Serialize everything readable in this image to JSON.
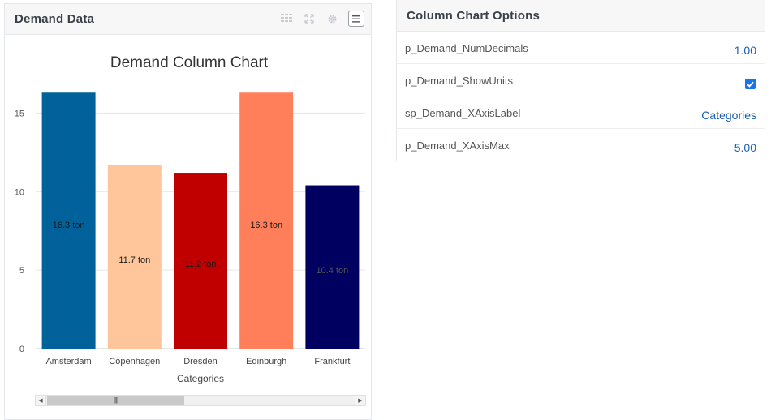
{
  "widget": {
    "title": "Demand Data",
    "icons": [
      "table-icon",
      "expand-icon",
      "gear-icon",
      "menu-icon"
    ]
  },
  "chart_data": {
    "type": "bar",
    "title": "Demand Column Chart",
    "xlabel": "Categories",
    "ylabel": "",
    "categories": [
      "Amsterdam",
      "Copenhagen",
      "Dresden",
      "Edinburgh",
      "Frankfurt"
    ],
    "values": [
      16.3,
      11.7,
      11.2,
      16.3,
      10.4
    ],
    "data_labels": [
      "16.3 ton",
      "11.7 ton",
      "11.2 ton",
      "16.3 ton",
      "10.4 ton"
    ],
    "colors": [
      "#01619b",
      "#fec69a",
      "#c00000",
      "#ff7f5b",
      "#000060"
    ],
    "label_colors": [
      "#1a1a1a",
      "#1a1a1a",
      "#1a1a1a",
      "#1a1a1a",
      "#555555"
    ],
    "yticks": [
      0,
      5,
      10,
      15
    ],
    "ylim": [
      0,
      17.5
    ],
    "grid": true,
    "legend": "none"
  },
  "options": {
    "title": "Column Chart Options",
    "rows": [
      {
        "label": "p_Demand_NumDecimals",
        "value": "1.00"
      },
      {
        "label": "p_Demand_ShowUnits",
        "checked": true
      },
      {
        "label": "sp_Demand_XAxisLabel",
        "value": "Categories"
      },
      {
        "label": "p_Demand_XAxisMax",
        "value": "5.00"
      }
    ]
  }
}
